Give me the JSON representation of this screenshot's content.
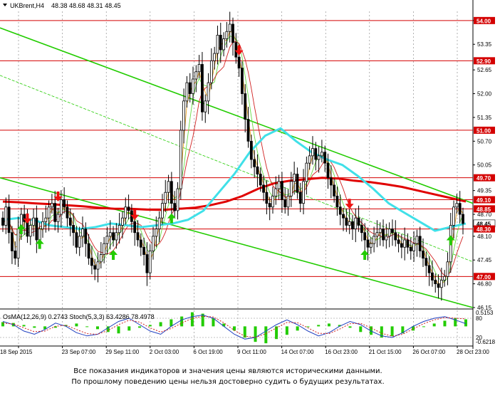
{
  "header": {
    "symbol_timeframe": "UKBrent,H4",
    "ohlc": "48.38 48.68 48.31 48.45"
  },
  "colors": {
    "background": "#ffffff",
    "candle": "#000000",
    "level_line": "#d40000",
    "channel": "#22cc00",
    "ma_cyan": "#40e0e8",
    "ma_red": "#e00000",
    "ma_thin_red": "#d02020",
    "ma_orange": "#e8a020",
    "ma_lightgreen": "#66dd44",
    "osma_bar": "#22cc00",
    "stoch_main": "#2040c0",
    "stoch_signal": "#d02020",
    "label_bg": "#d40000",
    "label_text": "#ffffff",
    "arrow_up": "#22cc00",
    "arrow_down": "#ee1111",
    "grid": "#000000"
  },
  "chart_data": {
    "type": "candlestick",
    "title": "UKBrent,H4",
    "ylim": [
      46.15,
      54.25
    ],
    "y_ticks": [
      "54.00",
      "53.35",
      "52.65",
      "52.00",
      "51.35",
      "50.70",
      "50.05",
      "49.35",
      "48.70",
      "48.10",
      "47.45",
      "46.80",
      "46.15"
    ],
    "price_levels": [
      {
        "value": 54.0,
        "label": "54.00"
      },
      {
        "value": 52.9,
        "label": "52.90"
      },
      {
        "value": 51.0,
        "label": "51.00"
      },
      {
        "value": 49.7,
        "label": "49.70"
      },
      {
        "value": 49.1,
        "label": "49.10"
      },
      {
        "value": 48.85,
        "label": "48.85"
      },
      {
        "value": 48.45,
        "label": "48.45"
      },
      {
        "value": 48.3,
        "label": "48.30"
      },
      {
        "value": 47.0,
        "label": "47.00"
      }
    ],
    "x_labels": [
      "18 Sep 2015",
      "23 Sep 07:00",
      "29 Sep 11:00",
      "2 Oct 03:00",
      "6 Oct 19:00",
      "9 Oct 11:00",
      "14 Oct 07:00",
      "16 Oct 23:00",
      "21 Oct 15:00",
      "26 Oct 07:00",
      "28 Oct 23:00"
    ],
    "closes": [
      48.4,
      48.9,
      48.2,
      47.7,
      47.5,
      48.3,
      48.7,
      48.5,
      48.1,
      48.4,
      48.6,
      48.0,
      48.3,
      48.5,
      48.6,
      48.9,
      49.0,
      48.5,
      48.7,
      49.1,
      48.9,
      48.6,
      48.4,
      48.2,
      47.8,
      48.1,
      48.3,
      47.9,
      47.5,
      47.3,
      47.2,
      47.4,
      47.6,
      47.9,
      48.1,
      48.2,
      48.0,
      48.2,
      48.4,
      48.6,
      48.9,
      48.8,
      48.5,
      48.2,
      48.0,
      47.8,
      47.6,
      47.1,
      47.7,
      48.1,
      48.3,
      48.6,
      49.0,
      49.3,
      49.6,
      49.0,
      48.8,
      49.4,
      51.0,
      51.8,
      52.3,
      52.0,
      52.4,
      52.6,
      52.8,
      51.5,
      51.8,
      52.3,
      52.9,
      53.1,
      53.6,
      53.2,
      53.5,
      53.7,
      53.9,
      53.4,
      53.0,
      52.7,
      52.0,
      51.3,
      50.7,
      50.2,
      50.0,
      49.8,
      49.5,
      49.3,
      49.0,
      48.9,
      49.2,
      49.4,
      49.6,
      49.1,
      48.9,
      49.2,
      49.6,
      49.8,
      49.3,
      49.0,
      49.6,
      50.1,
      50.3,
      50.5,
      50.2,
      50.3,
      50.4,
      50.1,
      49.7,
      49.5,
      49.2,
      48.9,
      48.7,
      48.6,
      48.4,
      48.5,
      48.3,
      48.6,
      48.4,
      48.2,
      48.0,
      47.8,
      47.9,
      48.1,
      48.2,
      48.3,
      48.0,
      48.1,
      48.3,
      48.2,
      48.0,
      47.9,
      47.8,
      48.0,
      47.8,
      47.7,
      47.9,
      48.1,
      47.7,
      47.5,
      47.3,
      47.1,
      46.9,
      46.8,
      46.7,
      46.9,
      47.0,
      47.4,
      48.4,
      48.9,
      49.0,
      48.7,
      48.45
    ],
    "moving_averages": [
      {
        "color_key": "ma_red",
        "values": [
          49.05,
          49.03,
          49.0,
          48.98,
          48.95,
          48.92,
          48.88,
          48.85,
          48.85,
          48.83,
          48.82,
          48.85,
          48.88,
          48.95,
          49.05,
          49.2,
          49.4,
          49.55,
          49.62,
          49.66,
          49.7,
          49.68,
          49.62,
          49.58,
          49.52,
          49.45,
          49.35,
          49.25,
          49.15,
          49.05
        ]
      },
      {
        "color_key": "ma_cyan",
        "values": [
          48.55,
          48.6,
          48.55,
          48.4,
          48.35,
          48.3,
          48.35,
          48.45,
          48.4,
          48.35,
          48.4,
          48.45,
          48.55,
          48.8,
          49.3,
          49.8,
          50.4,
          50.85,
          51.05,
          50.7,
          50.4,
          50.2,
          50.05,
          49.75,
          49.4,
          49.0,
          48.75,
          48.5,
          48.25,
          48.35,
          48.45
        ]
      }
    ],
    "channel_lines": [
      {
        "from": [
          0,
          49.7
        ],
        "to": [
          1,
          46.15
        ]
      },
      {
        "from": [
          0,
          53.8
        ],
        "to": [
          1,
          49.0
        ]
      },
      {
        "from": [
          0,
          52.5
        ],
        "to": [
          1,
          47.4
        ]
      }
    ],
    "signals_up": [
      6,
      12,
      36,
      55,
      118,
      146
    ],
    "signals_down": [
      8,
      18,
      43,
      77,
      113
    ],
    "indicator": {
      "label": "OsMA(12,26,9) 0.2743  Stoch(5,3,3) 63.4286 78.4978",
      "ticks": [
        "0.5153",
        "80",
        "20",
        "-0.6218"
      ],
      "osma": [
        0.15,
        0.12,
        0.05,
        -0.05,
        -0.1,
        -0.05,
        0.05,
        0.1,
        0.0,
        -0.1,
        -0.2,
        -0.25,
        -0.15,
        -0.05,
        0.05,
        0.15,
        0.25,
        0.35,
        0.5,
        0.45,
        0.3,
        0.1,
        -0.15,
        -0.4,
        -0.55,
        -0.6,
        -0.45,
        -0.3,
        -0.15,
        0.0,
        0.05,
        0.1,
        0.05,
        -0.05,
        -0.2,
        -0.3,
        -0.4,
        -0.35,
        -0.25,
        -0.15,
        0.0,
        0.1,
        0.2,
        0.3,
        0.25
      ],
      "stoch_main": [
        70,
        60,
        40,
        30,
        45,
        65,
        55,
        35,
        25,
        30,
        50,
        70,
        80,
        60,
        40,
        30,
        55,
        75,
        85,
        90,
        80,
        55,
        30,
        15,
        20,
        40,
        60,
        75,
        60,
        40,
        25,
        35,
        55,
        70,
        60,
        40,
        25,
        20,
        35,
        55,
        70,
        80,
        85,
        75,
        63
      ],
      "stoch_signal": [
        65,
        62,
        50,
        38,
        40,
        55,
        58,
        45,
        32,
        30,
        42,
        60,
        74,
        68,
        50,
        37,
        48,
        65,
        80,
        86,
        84,
        66,
        42,
        24,
        20,
        32,
        50,
        67,
        66,
        50,
        33,
        32,
        46,
        63,
        64,
        50,
        33,
        24,
        30,
        47,
        63,
        75,
        82,
        80,
        78
      ]
    }
  },
  "footer": {
    "disclaimer_line1": "Все показания индикаторов и значения цены являются историческими данными.",
    "disclaimer_line2": "По прошлому поведению цены нельзя достоверно судить о будущих результатах."
  }
}
